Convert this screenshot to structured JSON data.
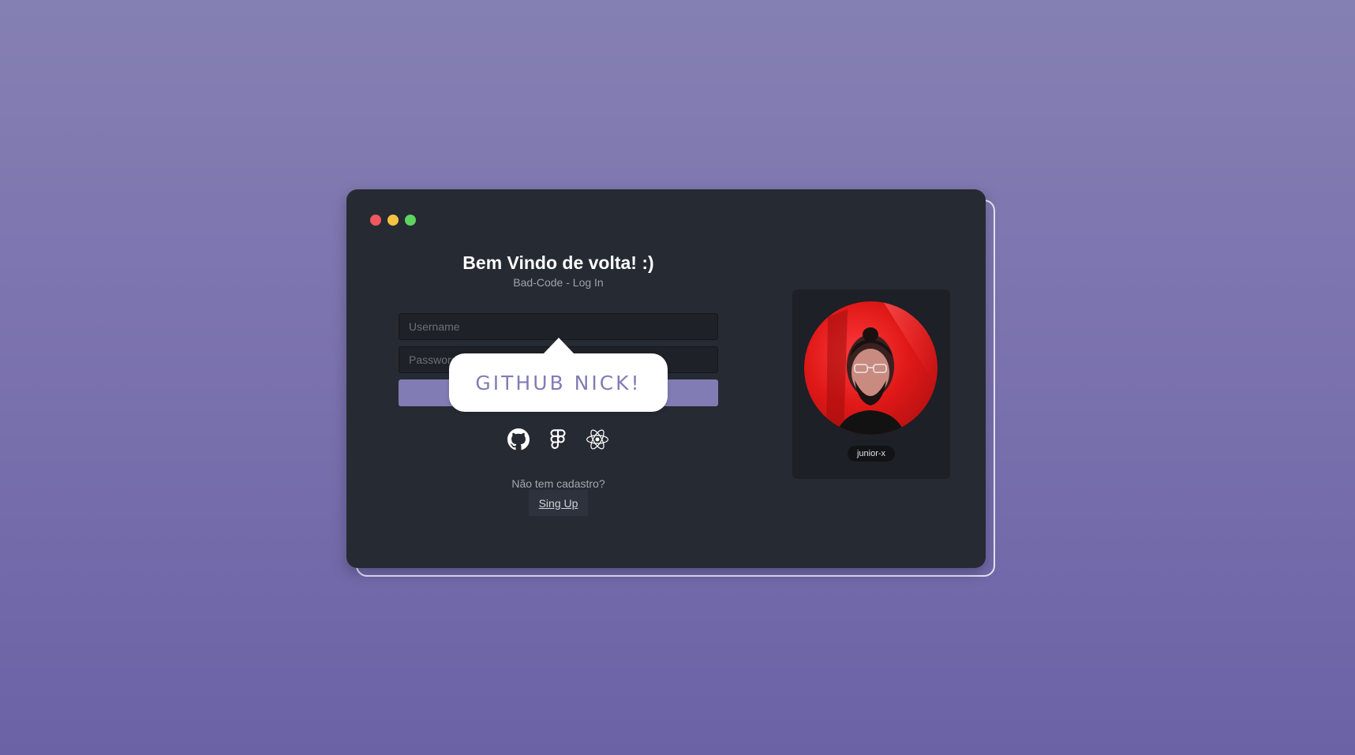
{
  "window": {
    "controls": [
      "close",
      "minimize",
      "maximize"
    ]
  },
  "login": {
    "title": "Bem Vindo de volta! :)",
    "subtitle": "Bad-Code - Log In",
    "username_placeholder": "Username",
    "password_placeholder": "Password",
    "submit_label": ""
  },
  "tooltip": {
    "text": "GITHUB NICK!"
  },
  "social": {
    "icons": [
      "github-icon",
      "figma-icon",
      "react-icon"
    ]
  },
  "signup": {
    "prompt": "Não tem cadastro?",
    "link_label": "Sing Up"
  },
  "profile": {
    "nick": "junior-x"
  },
  "colors": {
    "accent": "#827cb4",
    "window_bg": "#262a33",
    "card_bg": "#1d2026",
    "close": "#f0575e",
    "minimize": "#f5c242",
    "maximize": "#5fd35f"
  }
}
